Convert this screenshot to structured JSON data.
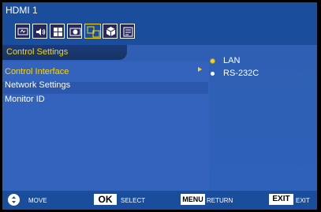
{
  "header": {
    "title": "HDMI 1"
  },
  "tabs": [
    {
      "icon": "picture-icon"
    },
    {
      "icon": "sound-icon"
    },
    {
      "icon": "layout-icon"
    },
    {
      "icon": "settings-icon"
    },
    {
      "icon": "control-icon",
      "active": true
    },
    {
      "icon": "cube-icon"
    },
    {
      "icon": "schedule-icon"
    }
  ],
  "submenu": {
    "title": "Control Settings",
    "items": [
      {
        "label": "Control Interface",
        "selected": true
      },
      {
        "label": "Network Settings"
      },
      {
        "label": "Monitor ID"
      }
    ]
  },
  "options": [
    {
      "label": "LAN",
      "checked": true
    },
    {
      "label": "RS-232C",
      "checked": false
    }
  ],
  "status": {
    "move_label": "MOVE",
    "ok_key": "OK",
    "select_label": "SELECT",
    "menu_key": "MENU",
    "return_label": "RETURN",
    "exit_key": "EXIT",
    "exit_label": "EXIT"
  },
  "colors": {
    "title_bar": "#1a4d9c",
    "panel": "#2e5fb3",
    "highlight": "#ffd400"
  }
}
